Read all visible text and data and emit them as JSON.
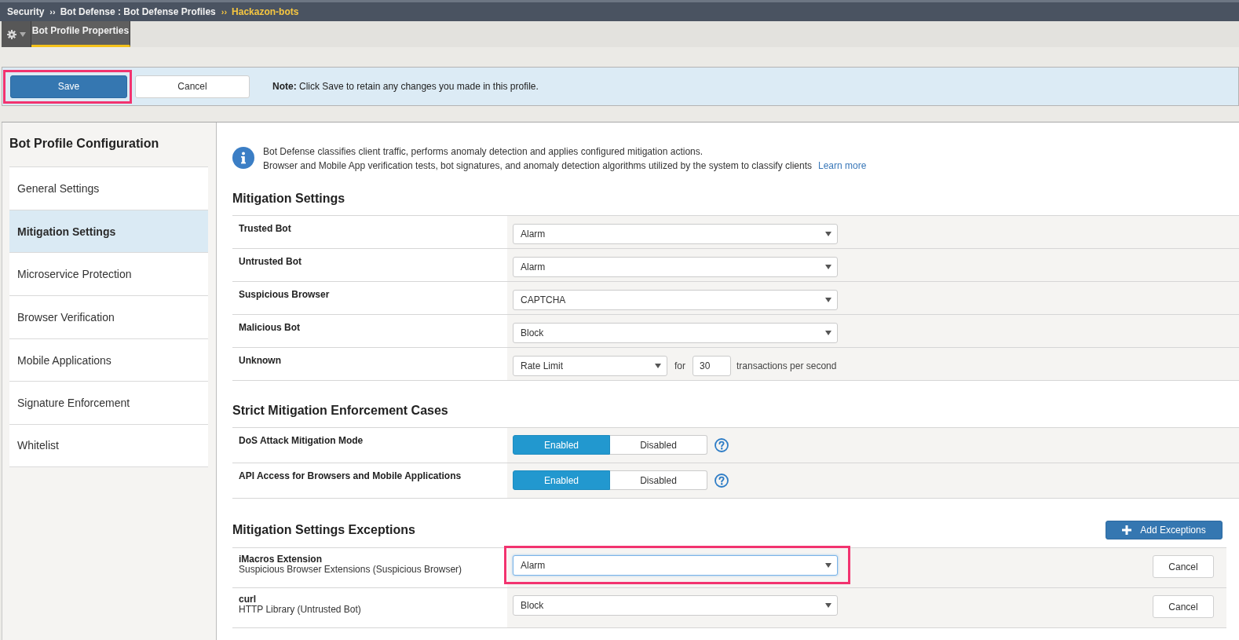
{
  "breadcrumb": [
    {
      "label": "Security",
      "current": false
    },
    {
      "label": "Bot Defense : Bot Defense Profiles",
      "separator": "››",
      "current": false
    },
    {
      "label": "Hackazon-bots",
      "separator": "››",
      "current": true
    }
  ],
  "tabs": [
    {
      "label": "Bot Profile Properties",
      "selected": true
    }
  ],
  "save_bar": {
    "buttons": [
      {
        "label": "Save",
        "kind": "primary",
        "highlighted": true
      },
      {
        "label": "Cancel",
        "kind": "secondary",
        "highlighted": false
      }
    ],
    "note": "**Note:** Click Save to retain any changes you made in this profile."
  },
  "sidebar": {
    "title": "Bot Profile Configuration",
    "items": [
      {
        "label": "General Settings",
        "selected": false
      },
      {
        "label": "Mitigation Settings",
        "selected": true
      },
      {
        "label": "Microservice Protection",
        "selected": false
      },
      {
        "label": "Browser Verification",
        "selected": false
      },
      {
        "label": "Mobile Applications",
        "selected": false
      },
      {
        "label": "Signature Enforcement",
        "selected": false
      },
      {
        "label": "Whitelist",
        "selected": false
      }
    ]
  },
  "info": {
    "lines": [
      "Bot Defense classifies client traffic, performs anomaly detection and applies configured mitigation actions.",
      "Browser and Mobile App verification tests, bot signatures, and anomaly detection algorithms utilized by the system to classify clients"
    ],
    "link": "Learn more"
  },
  "sections": [
    {
      "title": "Mitigation Settings",
      "rows": [
        {
          "label": "Trusted Bot",
          "kind": "select",
          "value": "Alarm"
        },
        {
          "label": "Untrusted Bot",
          "kind": "select",
          "value": "Alarm"
        },
        {
          "label": "Suspicious Browser",
          "kind": "select",
          "value": "CAPTCHA"
        },
        {
          "label": "Malicious Bot",
          "kind": "select",
          "value": "Block"
        },
        {
          "label": "Unknown",
          "kind": "rate",
          "value": "Rate Limit",
          "joiner": "for",
          "rate": "30",
          "unit": "transactions per second"
        }
      ]
    },
    {
      "title": "Strict Mitigation Enforcement Cases",
      "rows": [
        {
          "label": "DoS Attack Mitigation Mode",
          "kind": "toggle",
          "options": [
            {
              "label": "Enabled",
              "selected": true
            },
            {
              "label": "Disabled",
              "selected": false
            }
          ]
        },
        {
          "label": "API Access for Browsers and Mobile Applications",
          "kind": "toggle",
          "options": [
            {
              "label": "Enabled",
              "selected": true
            },
            {
              "label": "Disabled",
              "selected": false
            }
          ]
        }
      ]
    }
  ],
  "exceptions": {
    "title": "Mitigation Settings Exceptions",
    "add_button": "Add Exceptions",
    "rows": [
      {
        "name": "iMacros Extension",
        "detail": "Suspicious Browser Extensions (Suspicious Browser)",
        "value": "Alarm",
        "focused": true,
        "highlighted": true,
        "cancel": "Cancel"
      },
      {
        "name": "curl",
        "detail": "HTTP Library (Untrusted Bot)",
        "value": "Block",
        "focused": false,
        "highlighted": false,
        "cancel": "Cancel"
      }
    ]
  }
}
